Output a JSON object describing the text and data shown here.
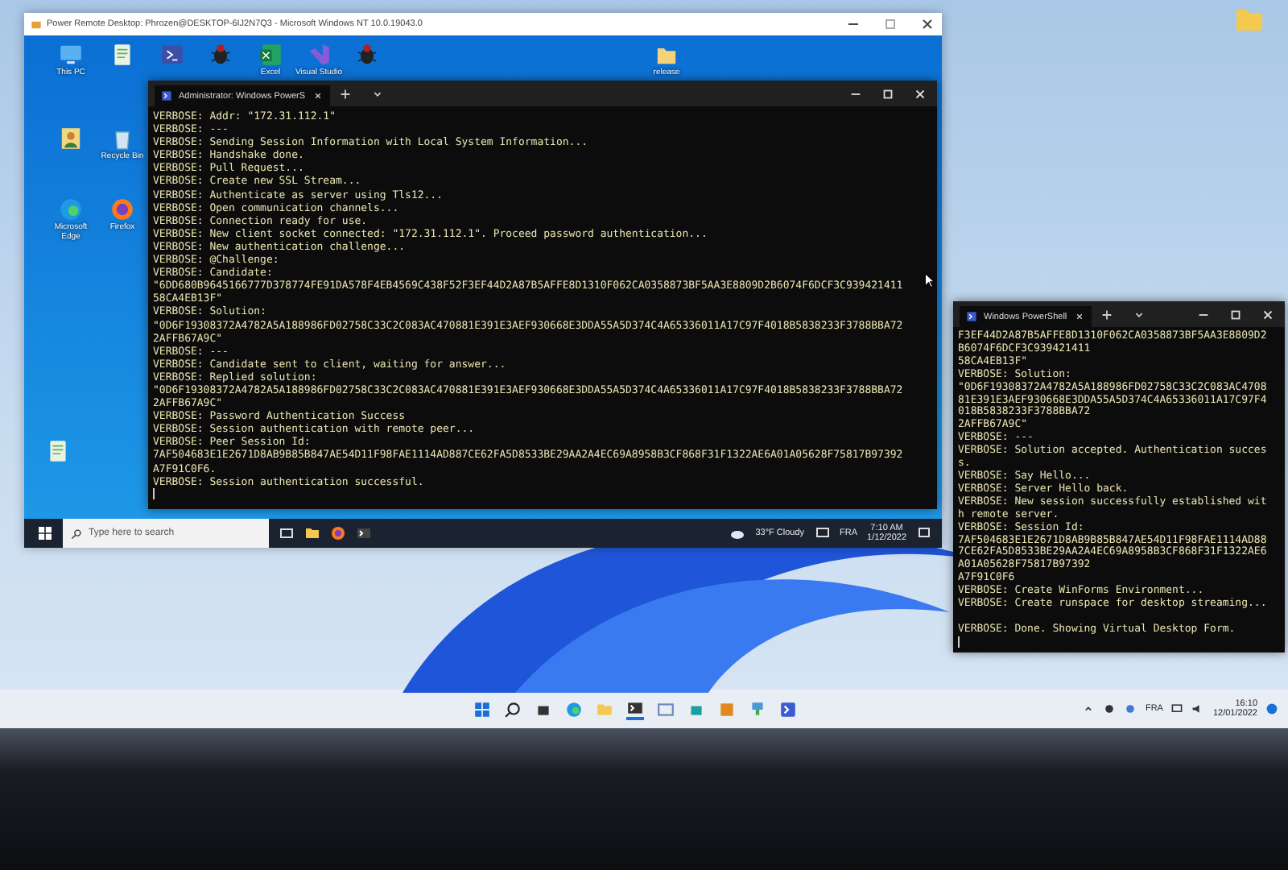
{
  "remote_window": {
    "title": "Power Remote Desktop: Phrozen@DESKTOP-6IJ2N7Q3 - Microsoft Windows NT 10.0.19043.0",
    "desktop_icons": [
      {
        "kind": "pc",
        "label": "This PC"
      },
      {
        "kind": "notepad"
      },
      {
        "kind": "powershell"
      },
      {
        "kind": "bug"
      },
      {
        "kind": "excel",
        "label": "Excel"
      },
      {
        "kind": "vs",
        "label": "Visual Studio"
      },
      {
        "kind": "bug"
      },
      {
        "kind": "folder",
        "label": "release"
      },
      {
        "kind": "user"
      },
      {
        "kind": "recycle",
        "label": "Recycle Bin"
      },
      {
        "kind": "edge",
        "label": "Microsoft Edge"
      },
      {
        "kind": "firefox",
        "label": "Firefox"
      },
      {
        "kind": "notepad"
      }
    ],
    "terminal": {
      "tab_title": "Administrator: Windows PowerS",
      "lines": [
        "VERBOSE: Addr: \"172.31.112.1\"",
        "VERBOSE: ---",
        "VERBOSE: Sending Session Information with Local System Information...",
        "VERBOSE: Handshake done.",
        "VERBOSE: Pull Request...",
        "VERBOSE: Create new SSL Stream...",
        "VERBOSE: Authenticate as server using Tls12...",
        "VERBOSE: Open communication channels...",
        "VERBOSE: Connection ready for use.",
        "VERBOSE: New client socket connected: \"172.31.112.1\". Proceed password authentication...",
        "VERBOSE: New authentication challenge...",
        "VERBOSE: @Challenge:",
        "VERBOSE: Candidate:",
        "\"6DD680B9645166777D378774FE91DA578F4EB4569C438F52F3EF44D2A87B5AFFE8D1310F062CA0358873BF5AA3E8809D2B6074F6DCF3C939421411",
        "58CA4EB13F\"",
        "VERBOSE: Solution:",
        "\"0D6F19308372A4782A5A188986FD02758C33C2C083AC470881E391E3AEF930668E3DDA55A5D374C4A65336011A17C97F4018B5838233F3788BBA72",
        "2AFFB67A9C\"",
        "VERBOSE: ---",
        "VERBOSE: Candidate sent to client, waiting for answer...",
        "VERBOSE: Replied solution:",
        "\"0D6F19308372A4782A5A188986FD02758C33C2C083AC470881E391E3AEF930668E3DDA55A5D374C4A65336011A17C97F4018B5838233F3788BBA72",
        "2AFFB67A9C\"",
        "VERBOSE: Password Authentication Success",
        "VERBOSE: Session authentication with remote peer...",
        "VERBOSE: Peer Session Id:",
        "7AF504683E1E2671D8AB9B85B847AE54D11F98FAE1114AD887CE62FA5D8533BE29AA2A4EC69A8958B3CF868F31F1322AE6A01A05628F75817B97392",
        "A7F91C0F6.",
        "VERBOSE: Session authentication successful."
      ]
    },
    "taskbar": {
      "search_placeholder": "Type here to search",
      "weather": "33°F Cloudy",
      "language": "FRA",
      "time": "7:10 AM",
      "date": "1/12/2022"
    }
  },
  "local_terminal": {
    "tab_title": "Windows PowerShell",
    "lines": [
      {
        "text": "F3EF44D2A87B5AFFE8D1310F062CA0358873BF5AA3E8809D2"
      },
      {
        "text": "B6074F6DCF3C939421411"
      },
      {
        "text": "58CA4EB13F\""
      },
      {
        "text": "VERBOSE: Solution:"
      },
      {
        "text": "\"0D6F19308372A4782A5A188986FD02758C33C2C083AC4708"
      },
      {
        "text": "81E391E3AEF930668E3DDA55A5D374C4A65336011A17C97F4"
      },
      {
        "text": "018B5838233F3788BBA72"
      },
      {
        "text": "2AFFB67A9C\""
      },
      {
        "text": "VERBOSE: ---"
      },
      {
        "text": "VERBOSE: Solution accepted. Authentication succes"
      },
      {
        "text": "s."
      },
      {
        "text": "VERBOSE: Say Hello..."
      },
      {
        "text": "VERBOSE: Server Hello back."
      },
      {
        "text": "VERBOSE: New session successfully established wit"
      },
      {
        "text": "h remote server."
      },
      {
        "text": "VERBOSE: Session Id:"
      },
      {
        "text": "7AF504683E1E2671D8AB9B85B847AE54D11F98FAE1114AD88"
      },
      {
        "text": "7CE62FA5D8533BE29AA2A4EC69A8958B3CF868F31F1322AE6"
      },
      {
        "text": "A01A05628F75817B97392"
      },
      {
        "text": "A7F91C0F6"
      },
      {
        "text": "VERBOSE: Create WinForms Environment..."
      },
      {
        "text": "VERBOSE: Create runspace for desktop streaming..."
      },
      {
        "text": "VERBOSE: Done. Showing Virtual Desktop Form.",
        "gap_before": true
      }
    ]
  },
  "taskbar": {
    "language": "FRA",
    "time": "16:10",
    "date": "12/01/2022"
  }
}
